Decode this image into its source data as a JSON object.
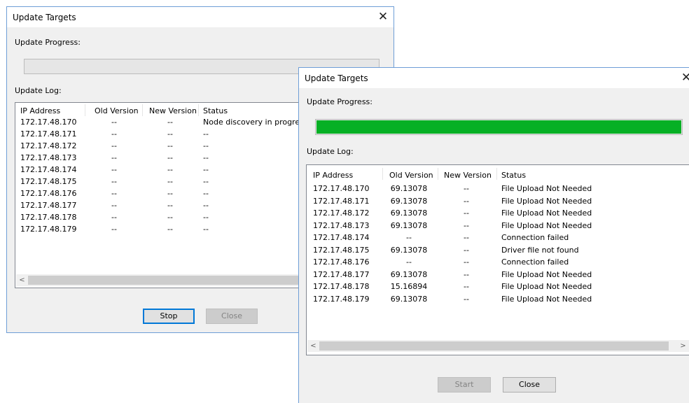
{
  "dialog1": {
    "title": "Update Targets",
    "close_icon": "✕",
    "progress_label": "Update Progress:",
    "progress_value": 0,
    "log_label": "Update Log:",
    "columns": [
      "IP Address",
      "Old Version",
      "New Version",
      "Status"
    ],
    "rows": [
      [
        "172.17.48.170",
        "--",
        "--",
        "Node discovery in progress"
      ],
      [
        "172.17.48.171",
        "--",
        "--",
        "--"
      ],
      [
        "172.17.48.172",
        "--",
        "--",
        "--"
      ],
      [
        "172.17.48.173",
        "--",
        "--",
        "--"
      ],
      [
        "172.17.48.174",
        "--",
        "--",
        "--"
      ],
      [
        "172.17.48.175",
        "--",
        "--",
        "--"
      ],
      [
        "172.17.48.176",
        "--",
        "--",
        "--"
      ],
      [
        "172.17.48.177",
        "--",
        "--",
        "--"
      ],
      [
        "172.17.48.178",
        "--",
        "--",
        "--"
      ],
      [
        "172.17.48.179",
        "--",
        "--",
        "--"
      ]
    ],
    "scroll_left": "<",
    "buttons": {
      "stop": "Stop",
      "close": "Close"
    }
  },
  "dialog2": {
    "title": "Update Targets",
    "close_icon": "✕",
    "progress_label": "Update Progress:",
    "progress_value": 1.0,
    "log_label": "Update Log:",
    "columns": [
      "IP Address",
      "Old Version",
      "New Version",
      "Status"
    ],
    "rows": [
      [
        "172.17.48.170",
        "69.13078",
        "--",
        "File Upload Not Needed"
      ],
      [
        "172.17.48.171",
        "69.13078",
        "--",
        "File Upload Not Needed"
      ],
      [
        "172.17.48.172",
        "69.13078",
        "--",
        "File Upload Not Needed"
      ],
      [
        "172.17.48.173",
        "69.13078",
        "--",
        "File Upload Not Needed"
      ],
      [
        "172.17.48.174",
        "--",
        "--",
        "Connection failed"
      ],
      [
        "172.17.48.175",
        "69.13078",
        "--",
        "Driver file not found"
      ],
      [
        "172.17.48.176",
        "--",
        "--",
        "Connection failed"
      ],
      [
        "172.17.48.177",
        "69.13078",
        "--",
        "File Upload Not Needed"
      ],
      [
        "172.17.48.178",
        "15.16894",
        "--",
        "File Upload Not Needed"
      ],
      [
        "172.17.48.179",
        "69.13078",
        "--",
        "File Upload Not Needed"
      ]
    ],
    "scroll_left": "<",
    "scroll_right": ">",
    "buttons": {
      "start": "Start",
      "close": "Close"
    }
  },
  "colors": {
    "progress_fill": "#06b025",
    "window_border": "#6e9ed7",
    "focus": "#0078d7"
  }
}
